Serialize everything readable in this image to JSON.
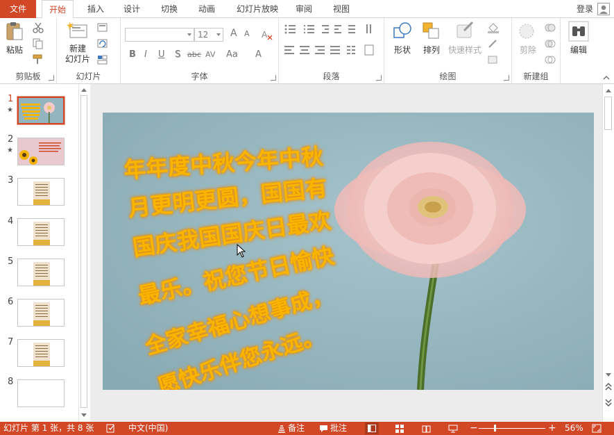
{
  "tabs": {
    "file": "文件",
    "home": "开始",
    "insert": "插入",
    "design": "设计",
    "transitions": "切换",
    "animations": "动画",
    "slideshow": "幻灯片放映",
    "review": "审阅",
    "view": "视图",
    "login": "登录"
  },
  "ribbon": {
    "clipboard": {
      "label": "剪贴板",
      "paste": "粘贴"
    },
    "slides": {
      "label": "幻灯片",
      "new_slide_line1": "新建",
      "new_slide_line2": "幻灯片"
    },
    "font": {
      "label": "字体",
      "font_name": "",
      "font_size": "12",
      "bold": "B",
      "italic": "I",
      "underline": "U",
      "shadow": "S",
      "strike": "abc",
      "spacing": "AV",
      "case": "Aa",
      "color": "A",
      "grow": "A",
      "shrink": "A"
    },
    "paragraph": {
      "label": "段落"
    },
    "drawing": {
      "label": "绘图",
      "shapes": "形状",
      "arrange": "排列",
      "quick_styles": "快速样式"
    },
    "newgroup": {
      "label": "新建组",
      "cut": "剪除"
    },
    "editing": {
      "label": "编辑"
    }
  },
  "thumbnails": [
    {
      "num": "1",
      "star": "★"
    },
    {
      "num": "2",
      "star": "★"
    },
    {
      "num": "3",
      "star": ""
    },
    {
      "num": "4",
      "star": ""
    },
    {
      "num": "5",
      "star": ""
    },
    {
      "num": "6",
      "star": ""
    },
    {
      "num": "7",
      "star": ""
    },
    {
      "num": "8",
      "star": ""
    }
  ],
  "slide": {
    "poem_lines": [
      "年年度中秋今年中秋",
      "月更明更圆，国国有",
      "国庆我国国庆日最欢",
      "最乐。祝您节日愉快",
      "全家幸福心想事成，",
      "愿快乐伴您永远。"
    ],
    "text_color": "#f7b500",
    "background_color": "#93b5bf"
  },
  "statusbar": {
    "slide_info": "幻灯片 第 1 张，共 8 张",
    "language": "中文(中国)",
    "notes": "备注",
    "comments": "批注",
    "zoom": "56%"
  },
  "colors": {
    "accent": "#d24726"
  }
}
